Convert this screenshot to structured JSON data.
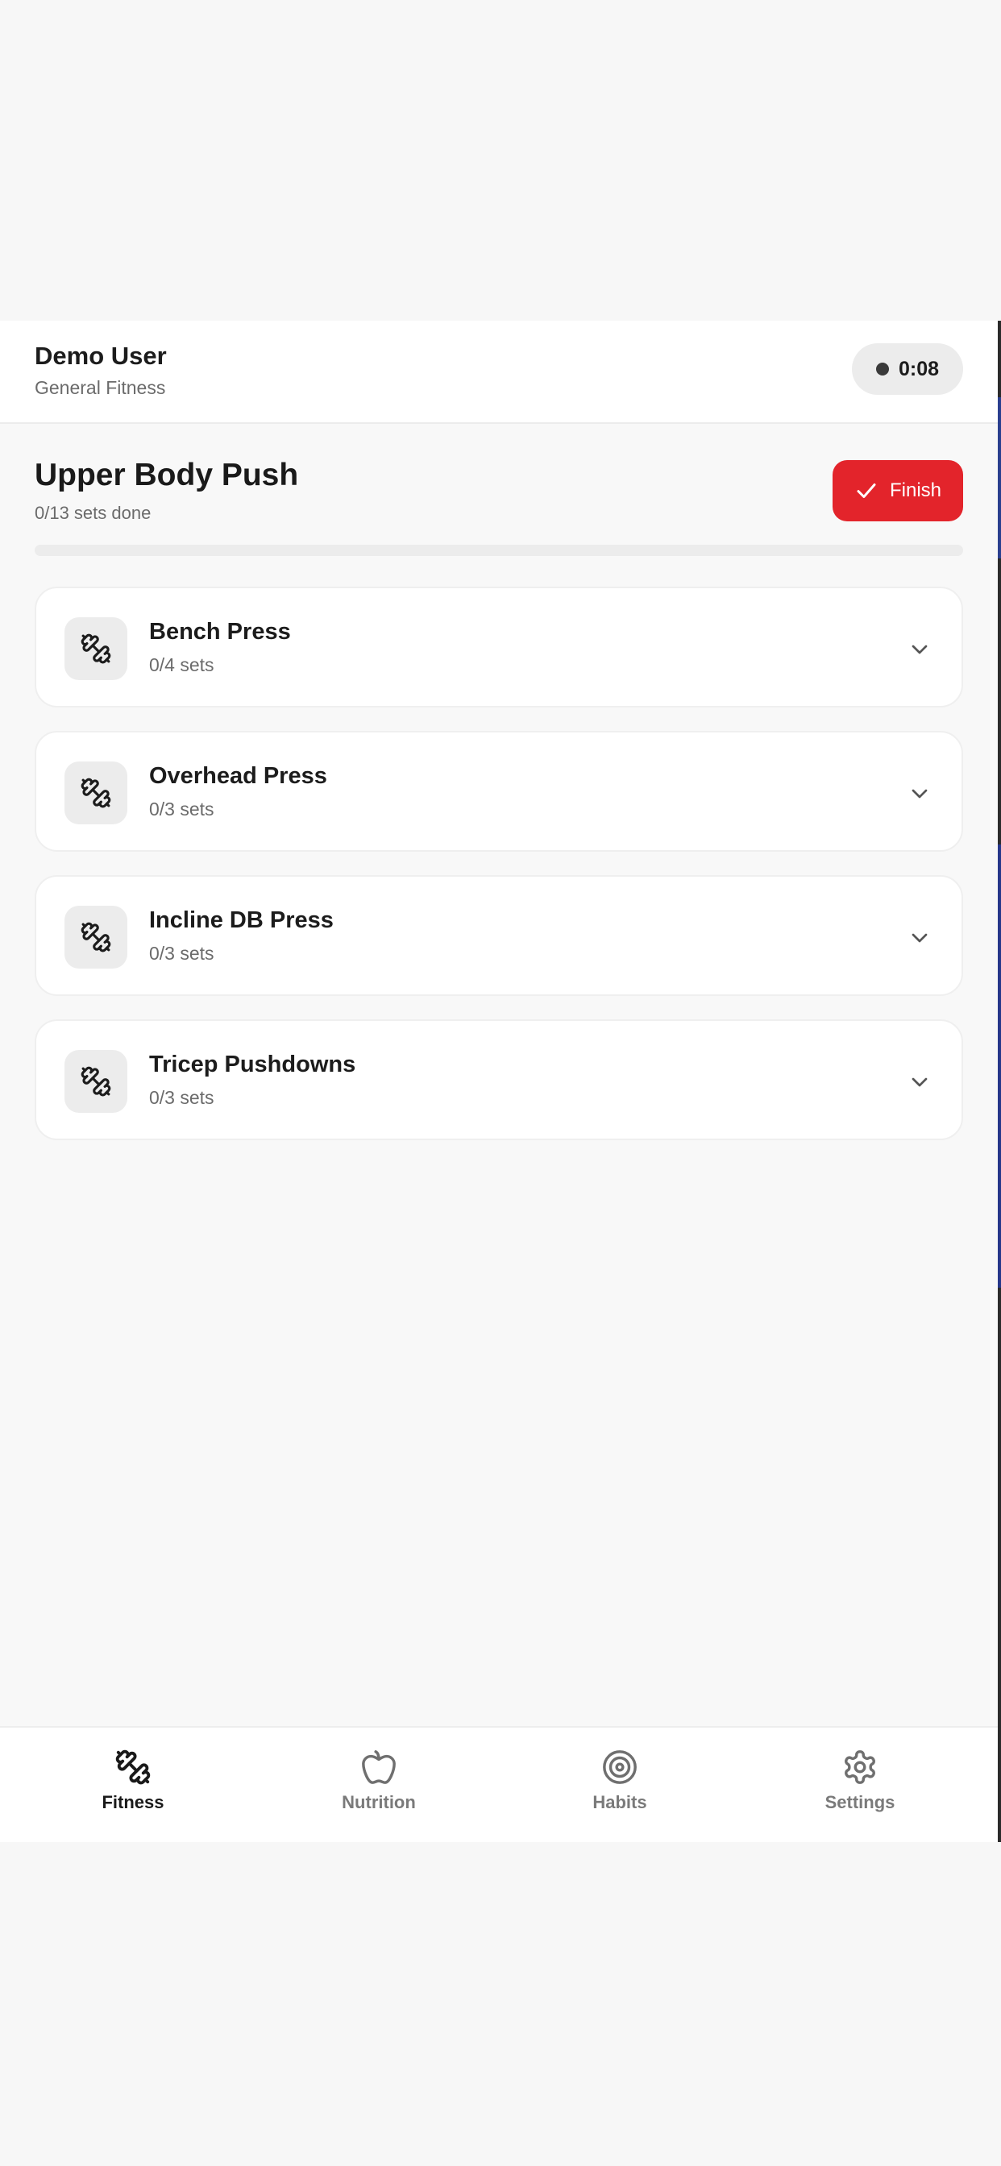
{
  "header": {
    "user_name": "Demo User",
    "user_subtitle": "General Fitness",
    "timer": "0:08"
  },
  "workout": {
    "title": "Upper Body Push",
    "progress_text": "0/13 sets done",
    "finish_label": "Finish",
    "progress_fraction": 0,
    "accent_color": "#e3242b"
  },
  "exercises": [
    {
      "name": "Bench Press",
      "sets": "0/4 sets",
      "icon": "dumbbell-icon"
    },
    {
      "name": "Overhead Press",
      "sets": "0/3 sets",
      "icon": "dumbbell-icon"
    },
    {
      "name": "Incline DB Press",
      "sets": "0/3 sets",
      "icon": "dumbbell-icon"
    },
    {
      "name": "Tricep Pushdowns",
      "sets": "0/3 sets",
      "icon": "dumbbell-icon"
    }
  ],
  "nav": {
    "items": [
      {
        "label": "Fitness",
        "icon": "dumbbell-icon",
        "active": true
      },
      {
        "label": "Nutrition",
        "icon": "apple-icon",
        "active": false
      },
      {
        "label": "Habits",
        "icon": "target-icon",
        "active": false
      },
      {
        "label": "Settings",
        "icon": "gear-icon",
        "active": false
      }
    ]
  }
}
